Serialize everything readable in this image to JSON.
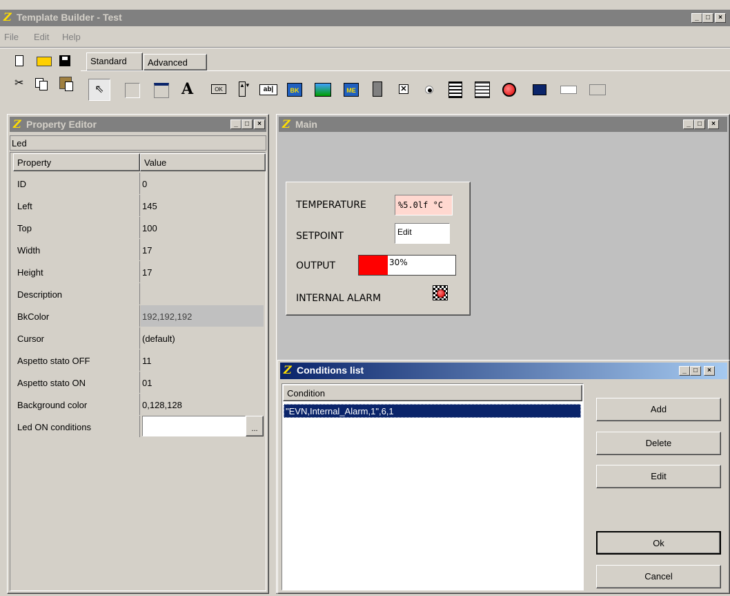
{
  "app": {
    "title": "Template Builder - Test"
  },
  "menu": [
    "File",
    "Edit",
    "Help"
  ],
  "tabs": [
    "Standard",
    "Advanced"
  ],
  "property_editor": {
    "title": "Property Editor",
    "object": "Led",
    "headers": [
      "Property",
      "Value"
    ],
    "rows": [
      {
        "property": "ID",
        "value": "0"
      },
      {
        "property": "Left",
        "value": "145"
      },
      {
        "property": "Top",
        "value": "100"
      },
      {
        "property": "Width",
        "value": "17"
      },
      {
        "property": "Height",
        "value": "17"
      },
      {
        "property": "Description",
        "value": ""
      },
      {
        "property": "BkColor",
        "value": "192,192,192"
      },
      {
        "property": "Cursor",
        "value": "(default)"
      },
      {
        "property": "Aspetto stato OFF",
        "value": "11"
      },
      {
        "property": "Aspetto stato ON",
        "value": "01"
      },
      {
        "property": "Background color",
        "value": "0,128,128"
      },
      {
        "property": "Led ON conditions",
        "value": ""
      }
    ],
    "ellipsis": "..."
  },
  "main": {
    "title": "Main",
    "temperature_label": "TEMPERATURE",
    "temperature_value": "%5.0lf °C",
    "setpoint_label": "SETPOINT",
    "setpoint_value": "Edit",
    "output_label": "OUTPUT",
    "output_value": "30%",
    "output_fraction": 0.3,
    "alarm_label": "INTERNAL ALARM"
  },
  "conditions": {
    "title": "Conditions list",
    "header": "Condition",
    "items": [
      "\"EVN,Internal_Alarm,1\",6,1"
    ],
    "buttons": {
      "add": "Add",
      "delete": "Delete",
      "edit": "Edit",
      "ok": "Ok",
      "cancel": "Cancel"
    }
  },
  "colors": {
    "accent": "#0a246a",
    "output_bar": "#ff0000",
    "temperature_bg": "#ffd8d0"
  }
}
